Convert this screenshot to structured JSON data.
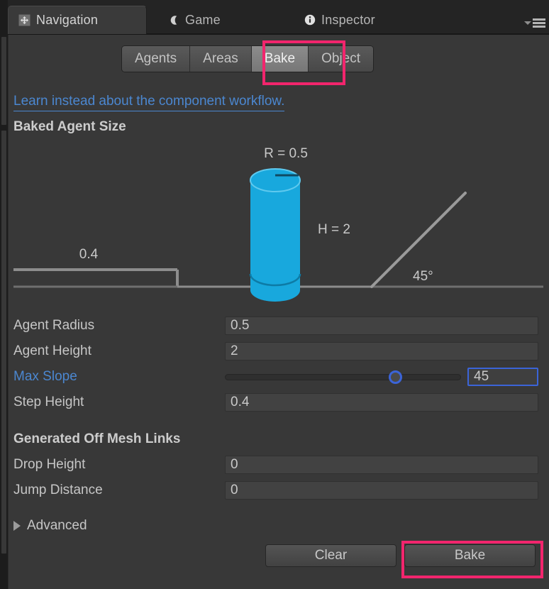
{
  "window": {
    "tabs": [
      {
        "label": "Navigation",
        "icon": "move-tool-icon",
        "active": true
      },
      {
        "label": "Game",
        "icon": "game-view-icon",
        "active": false
      },
      {
        "label": "Inspector",
        "icon": "info-circle-icon",
        "active": false
      }
    ],
    "menu_icon": "hamburger-menu-icon",
    "menu_dropdown_icon": "caret-down-icon"
  },
  "toolbar": {
    "segments": [
      {
        "label": "Agents",
        "selected": false
      },
      {
        "label": "Areas",
        "selected": false
      },
      {
        "label": "Bake",
        "selected": true
      },
      {
        "label": "Object",
        "selected": false
      }
    ]
  },
  "content": {
    "doc_link": "Learn instead about the component workflow.",
    "agent_size_header": "Baked Agent Size",
    "offmesh_header": "Generated Off Mesh Links",
    "advanced_label": "Advanced",
    "advanced_expanded": false
  },
  "diagram": {
    "radius_label": "R = 0.5",
    "height_label": "H = 2",
    "step_label": "0.4",
    "slope_label": "45°",
    "agent_color": "#18a8dd",
    "agent_color_dark": "#0d7ba6",
    "line_color": "#9a9a9a",
    "ground_color": "#7c7c7c"
  },
  "properties": [
    {
      "label": "Agent Radius",
      "value": "0.5",
      "type": "text",
      "accent": false
    },
    {
      "label": "Agent Height",
      "value": "2",
      "type": "text",
      "accent": false
    },
    {
      "label": "Max Slope",
      "value": "45",
      "type": "slider",
      "accent": true,
      "slider_percent": 72
    },
    {
      "label": "Step Height",
      "value": "0.4",
      "type": "text",
      "accent": false
    }
  ],
  "offmesh_properties": [
    {
      "label": "Drop Height",
      "value": "0",
      "type": "text",
      "accent": false
    },
    {
      "label": "Jump Distance",
      "value": "0",
      "type": "text",
      "accent": false
    }
  ],
  "buttons": {
    "clear": "Clear",
    "bake": "Bake"
  },
  "annotations": {
    "color": "#f2256d",
    "targets": [
      "bake-tab",
      "bake-button"
    ]
  }
}
